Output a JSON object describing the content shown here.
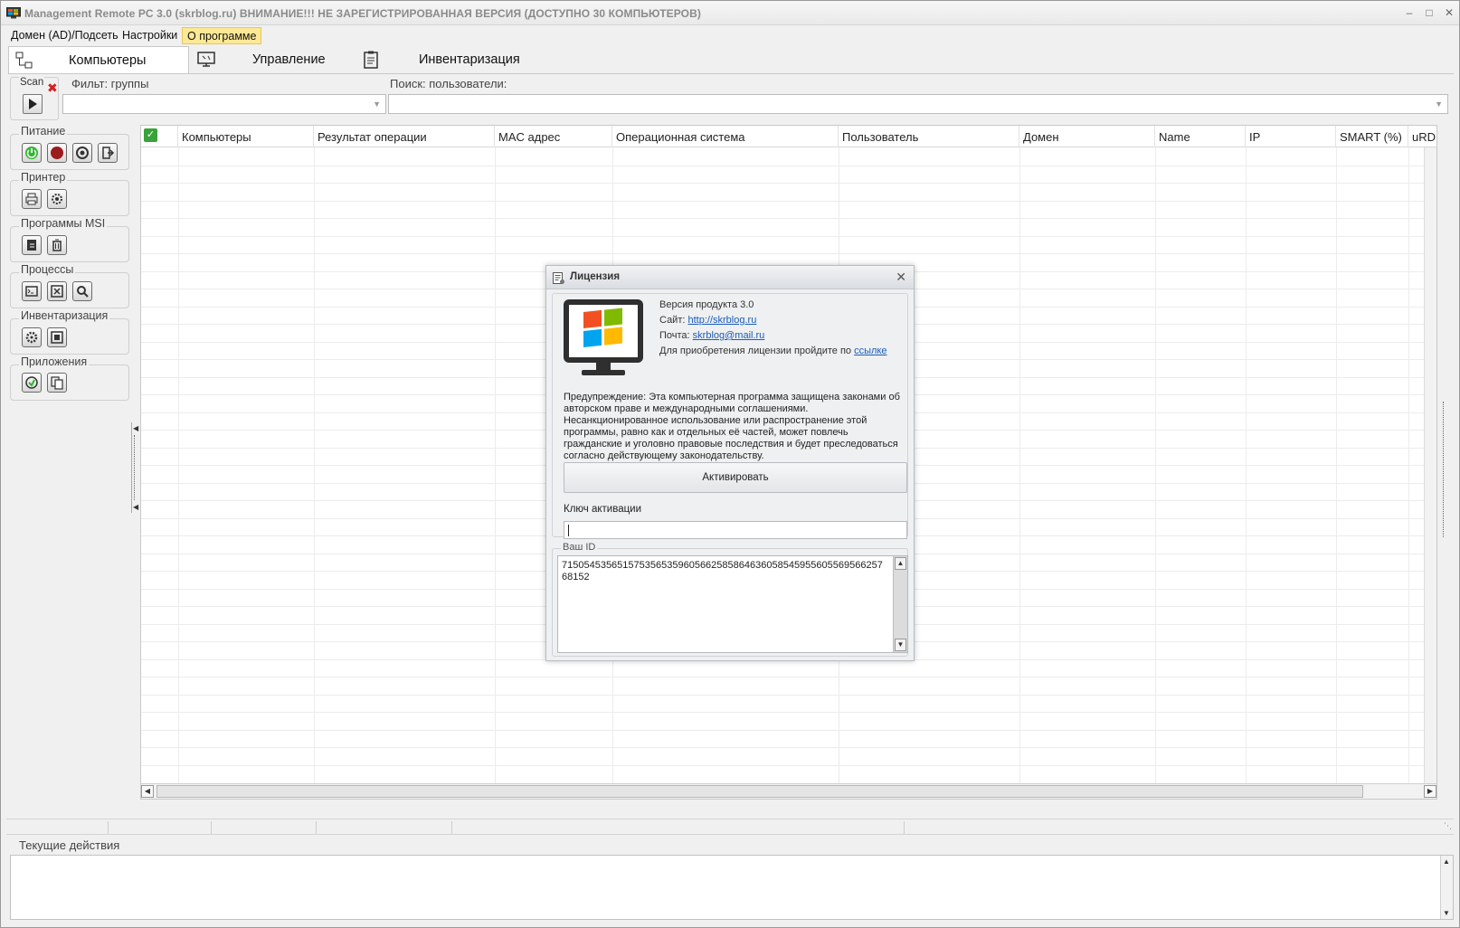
{
  "window": {
    "title": "Management Remote PC 3.0 (skrblog.ru) ВНИМАНИЕ!!! НЕ ЗАРЕГИСТРИРОВАННАЯ ВЕРСИЯ (ДОСТУПНО 30 КОМПЬЮТЕРОВ)"
  },
  "menu": {
    "items": [
      "Домен (AD)/Подсеть",
      "Настройки",
      "О программе"
    ],
    "active_index": 2
  },
  "tabs": [
    {
      "label": "Компьютеры",
      "icon": "network-icon",
      "active": true
    },
    {
      "label": "Управление",
      "icon": "remote-desktop-icon",
      "active": false
    },
    {
      "label": "Инвентаризация",
      "icon": "clipboard-icon",
      "active": false
    }
  ],
  "toolbar": {
    "scan_label": "Scan",
    "filter_label": "Фильт: группы",
    "filter_value": "",
    "search_label": "Поиск: пользователи:",
    "search_value": ""
  },
  "sidebar": {
    "groups": [
      {
        "label": "Питание",
        "buttons": [
          "power-on-icon",
          "power-off-icon",
          "restart-icon",
          "logoff-icon"
        ]
      },
      {
        "label": "Принтер",
        "buttons": [
          "printer-icon",
          "printer-settings-icon"
        ]
      },
      {
        "label": "Программы MSI",
        "buttons": [
          "install-msi-icon",
          "uninstall-icon"
        ]
      },
      {
        "label": "Процессы",
        "buttons": [
          "console-icon",
          "kill-process-icon",
          "search-process-icon"
        ]
      },
      {
        "label": "Инвентаризация",
        "buttons": [
          "inventory-settings-icon",
          "inventory-report-icon"
        ]
      },
      {
        "label": "Приложения",
        "buttons": [
          "app-run-icon",
          "app-copy-icon"
        ]
      }
    ]
  },
  "grid": {
    "columns": [
      "Компьютеры",
      "Результат операции",
      "MAC адрес",
      "Операционная система",
      "Пользователь",
      "Домен",
      "Name",
      "IP",
      "SMART (%)",
      "uRD"
    ],
    "rows": []
  },
  "current_actions": {
    "label": "Текущие действия"
  },
  "dialog": {
    "title": "Лицензия",
    "version": "Версия продукта 3.0",
    "site_label": "Сайт:",
    "site_link": "http://skrblog.ru",
    "mail_label": "Почта:",
    "mail_link": "skrblog@mail.ru",
    "purchase_text": "Для приобретения лицензии пройдите по",
    "purchase_link": "ссылке",
    "warning": "Предупреждение: Эта компьютерная программа защищена законами об авторском праве и международными соглашениями. Несанкционированное использование или распространение этой программы, равно как и отдельных её частей, может повлечь гражданские и уголовно правовые последствия и будет преследоваться согласно действующему законодательству.",
    "activate_button": "Активировать",
    "key_label": "Ключ активации",
    "key_value": "",
    "id_label": "Ваш ID",
    "id_value": "715054535651575356535960566258586463605854595560556956625768152"
  },
  "colors": {
    "accent_menu": "#fde995",
    "link": "#1a5cb8",
    "scan_stop": "#d62020"
  }
}
